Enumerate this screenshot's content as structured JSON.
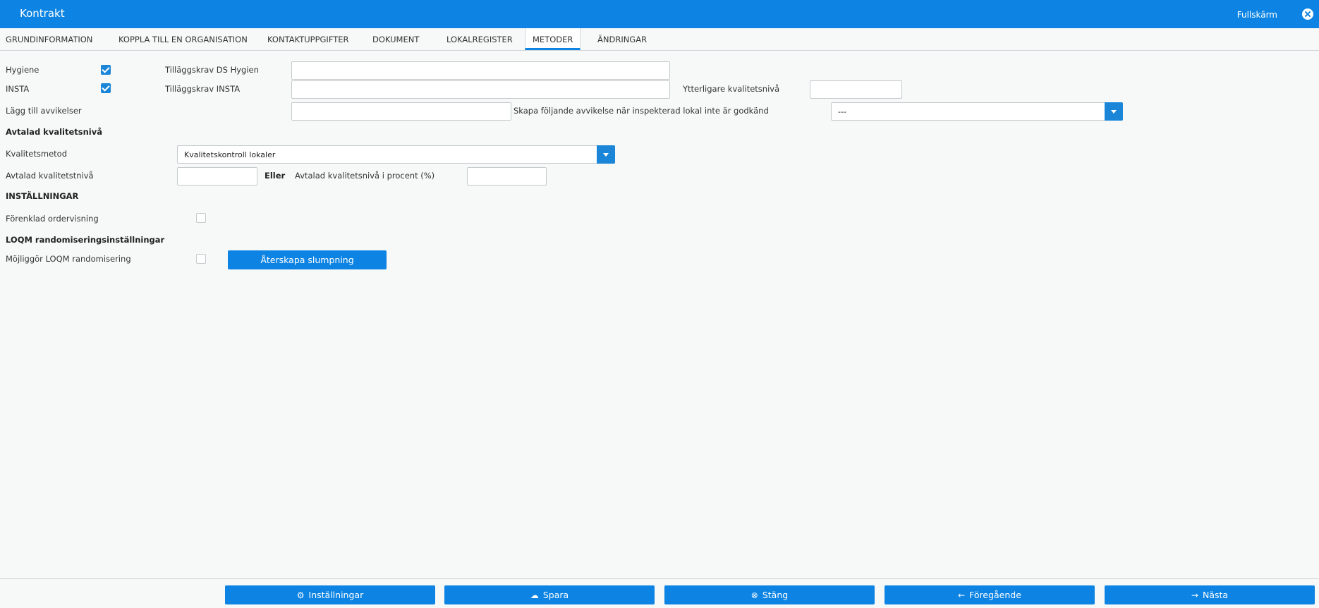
{
  "window": {
    "title": "Kontrakt",
    "fullscreen_label": "Fullskärm",
    "close_icon": "close-circle-icon"
  },
  "tabs": [
    {
      "label": "GRUNDINFORMATION",
      "active": false
    },
    {
      "label": "KOPPLA TILL EN ORGANISATION",
      "active": false
    },
    {
      "label": "KONTAKTUPPGIFTER",
      "active": false
    },
    {
      "label": "DOKUMENT",
      "active": false
    },
    {
      "label": "LOKALREGISTER",
      "active": false
    },
    {
      "label": "METODER",
      "active": true
    },
    {
      "label": "ÄNDRINGAR",
      "active": false
    }
  ],
  "form": {
    "hygiene": {
      "label": "Hygiene",
      "checked": true
    },
    "insta": {
      "label": "INSTA",
      "checked": true
    },
    "tillaggskrav_ds": {
      "label": "Tilläggskrav DS Hygien",
      "value": ""
    },
    "tillaggskrav_insta": {
      "label": "Tilläggskrav INSTA",
      "value": ""
    },
    "ytterligare": {
      "label": "Ytterligare kvalitetsnivå",
      "value": ""
    },
    "lagg_till": {
      "label": "Lägg till avvikelser",
      "value": ""
    },
    "skapa": {
      "label": "Skapa följande avvikelse när inspekterad lokal inte är godkänd",
      "value": "---"
    },
    "avtalad_header": "Avtalad kvalitetsnivå",
    "kvalitetsmetod": {
      "label": "Kvalitetsmetod",
      "value": "Kvalitetskontroll lokaler"
    },
    "avtalad_niva": {
      "label": "Avtalad kvalitetstnivå",
      "value": ""
    },
    "eller": "Eller",
    "avtalad_procent": {
      "label": "Avtalad kvalitetsnivå i procent (%)",
      "value": ""
    },
    "installningar_header": "INSTÄLLNINGAR",
    "forenklad": {
      "label": "Förenklad ordervisning",
      "checked": false
    },
    "loqm_header": "LOQM randomiseringsinställningar",
    "mojliggor": {
      "label": "Möjliggör LOQM randomisering",
      "checked": false
    },
    "aterskapa_label": "Återskapa slumpning"
  },
  "footer": {
    "installningar": {
      "label": "Inställningar",
      "icon": "gear-icon"
    },
    "spara": {
      "label": "Spara",
      "icon": "cloud-upload-icon"
    },
    "stang": {
      "label": "Stäng",
      "icon": "close-circle-icon"
    },
    "foregaende": {
      "label": "Föregående",
      "icon": "arrow-left-icon"
    },
    "nasta": {
      "label": "Nästa",
      "icon": "arrow-right-icon"
    }
  },
  "colors": {
    "accent": "#0d84e3",
    "checkbox": "#1b86d8",
    "background": "#f7f9f9"
  }
}
